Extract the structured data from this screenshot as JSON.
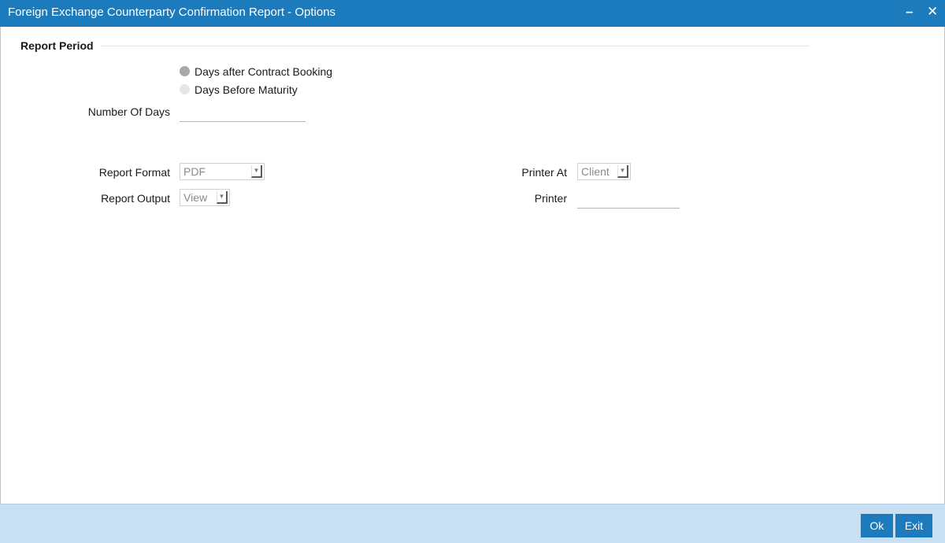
{
  "window": {
    "title": "Foreign Exchange Counterparty Confirmation Report - Options",
    "minimize_glyph": "–",
    "close_glyph": "✕"
  },
  "report_period": {
    "section_title": "Report Period",
    "options": [
      {
        "label": "Days after Contract Booking",
        "selected": true
      },
      {
        "label": "Days Before Maturity",
        "selected": false
      }
    ],
    "number_of_days_label": "Number Of Days",
    "number_of_days_value": ""
  },
  "report_settings": {
    "format_label": "Report Format",
    "format_value": "PDF",
    "output_label": "Report Output",
    "output_value": "View",
    "printer_at_label": "Printer At",
    "printer_at_value": "Client",
    "printer_label": "Printer",
    "printer_value": ""
  },
  "footer": {
    "ok_label": "Ok",
    "exit_label": "Exit"
  },
  "colors": {
    "titlebar": "#1b7bbd",
    "footer": "#c9e0f3",
    "button": "#1b7bbd"
  },
  "icons": {
    "minimize": "minimize-icon",
    "close": "close-icon",
    "dropdown": "chevron-down-icon"
  }
}
